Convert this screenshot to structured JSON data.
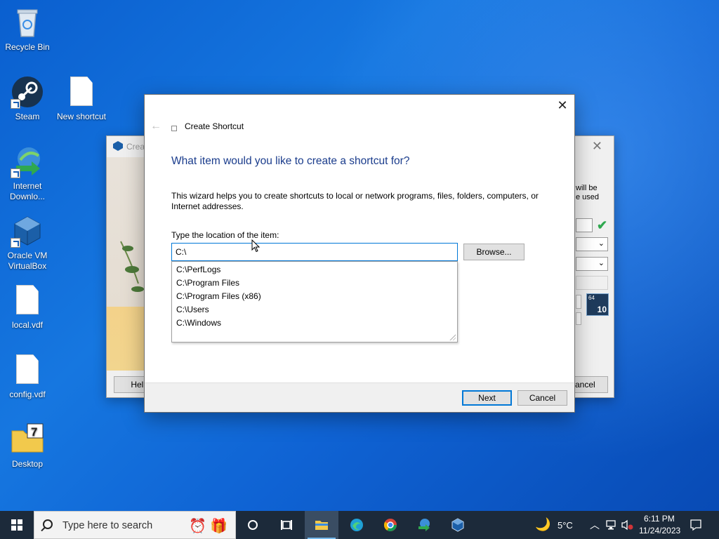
{
  "desktop": {
    "icons": [
      {
        "label": "Recycle Bin",
        "icon": "recycle-bin-icon"
      },
      {
        "label": "Steam",
        "icon": "steam-icon"
      },
      {
        "label": "New shortcut",
        "icon": "file-icon"
      },
      {
        "label": "Internet Downlo...",
        "icon": "internet-download-manager-icon"
      },
      {
        "label": "Oracle VM VirtualBox",
        "icon": "virtualbox-icon"
      },
      {
        "label": "local.vdf",
        "icon": "file-icon"
      },
      {
        "label": "config.vdf",
        "icon": "file-icon"
      },
      {
        "label": "Desktop",
        "icon": "folder-7zip-icon"
      }
    ]
  },
  "background_window": {
    "title": "Crea",
    "side_text_1": "will be",
    "side_text_2": "e used",
    "help_label": "Help",
    "cancel_label": "ancel",
    "badge_text": "10",
    "badge_small": "64"
  },
  "dialog": {
    "window_title": "Create Shortcut",
    "heading": "What item would you like to create a shortcut for?",
    "description": "This wizard helps you to create shortcuts to local or network programs, files, folders, computers, or Internet addresses.",
    "location_label": "Type the location of the item:",
    "location_value": "C:\\",
    "browse_label": "Browse...",
    "suggestions": [
      "C:\\PerfLogs",
      "C:\\Program Files",
      "C:\\Program Files (x86)",
      "C:\\Users",
      "C:\\Windows"
    ],
    "next_label": "Next",
    "cancel_label": "Cancel",
    "close_glyph": "✕",
    "back_glyph": "←"
  },
  "taskbar": {
    "search_placeholder": "Type here to search",
    "weather_temp": "5°C",
    "time": "6:11 PM",
    "date": "11/24/2023",
    "accent": "#76b9ed"
  }
}
